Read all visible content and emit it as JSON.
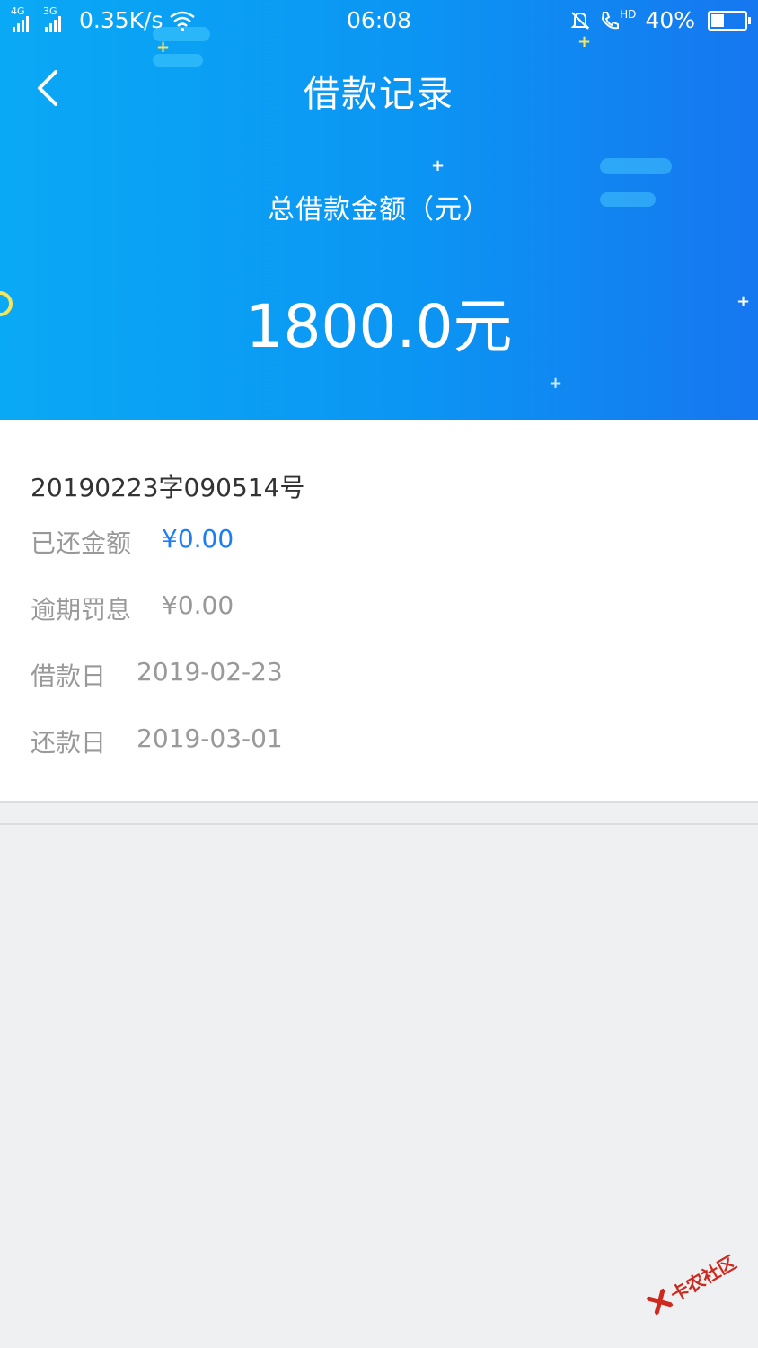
{
  "status_bar": {
    "signal1_tag": "4G",
    "signal2_tag": "3G",
    "speed": "0.35K/s",
    "time": "06:08",
    "call_tag": "HD",
    "battery": "40%",
    "battery_level": 0.4
  },
  "header": {
    "title": "借款记录",
    "back_icon": "chevron-left-icon"
  },
  "summary": {
    "label": "总借款金额（元）",
    "amount": "1800.0元"
  },
  "loan": {
    "number": "20190223字090514号",
    "rows": [
      {
        "label": "已还金额",
        "value": "¥0.00"
      },
      {
        "label": "逾期罚息",
        "value": "¥0.00"
      },
      {
        "label": "借款日",
        "value": "2019-02-23"
      },
      {
        "label": "还款日",
        "value": "2019-03-01"
      }
    ]
  },
  "watermark": {
    "text": "卡农社区"
  },
  "colors": {
    "accent_blue": "#1c7ef3",
    "header_gradient_start": "#0aa9f5",
    "header_gradient_end": "#1677f0",
    "watermark_red": "#cc2a1f"
  }
}
